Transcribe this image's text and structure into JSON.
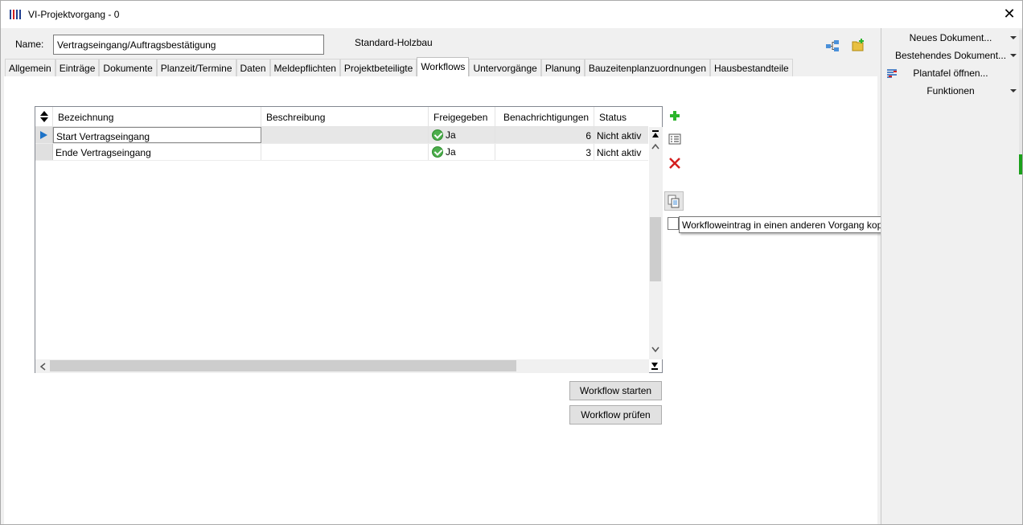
{
  "window": {
    "title": "VI-Projektvorgang - 0",
    "close_glyph": "✕"
  },
  "header": {
    "name_label": "Name:",
    "name_value": "Vertragseingang/Auftragsbestätigung",
    "standard_label": "Standard-Holzbau"
  },
  "tabs": [
    {
      "label": "Allgemein"
    },
    {
      "label": "Einträge"
    },
    {
      "label": "Dokumente"
    },
    {
      "label": "Planzeit/Termine"
    },
    {
      "label": "Daten"
    },
    {
      "label": "Meldepflichten"
    },
    {
      "label": "Projektbeteiligte"
    },
    {
      "label": "Workflows"
    },
    {
      "label": "Untervorgänge"
    },
    {
      "label": "Planung"
    },
    {
      "label": "Bauzeitenplanzuordnungen"
    },
    {
      "label": "Hausbestandteile"
    }
  ],
  "active_tab": "Workflows",
  "grid": {
    "columns": [
      "Bezeichnung",
      "Beschreibung",
      "Freigegeben",
      "Benachrichtigungen",
      "Status"
    ],
    "rows": [
      {
        "bezeichnung": "Start Vertragseingang",
        "beschreibung": "",
        "freigegeben": "Ja",
        "benachrichtigungen": "6",
        "status": "Nicht aktiv"
      },
      {
        "bezeichnung": "Ende Vertragseingang",
        "beschreibung": "",
        "freigegeben": "Ja",
        "benachrichtigungen": "3",
        "status": "Nicht aktiv"
      }
    ]
  },
  "buttons": {
    "start": "Workflow starten",
    "check": "Workflow prüfen"
  },
  "tooltip": "Workflowеintrag in einen anderen Vorgang kopieren",
  "right_pane": {
    "items": [
      "Neues Dokument...",
      "Bestehendes Dokument...",
      "Plantafel öffnen...",
      "Funktionen"
    ]
  },
  "colors": {
    "selection_arrow": "#1e73c8",
    "add_icon": "#2bb52b",
    "delete_icon": "#d42020"
  }
}
